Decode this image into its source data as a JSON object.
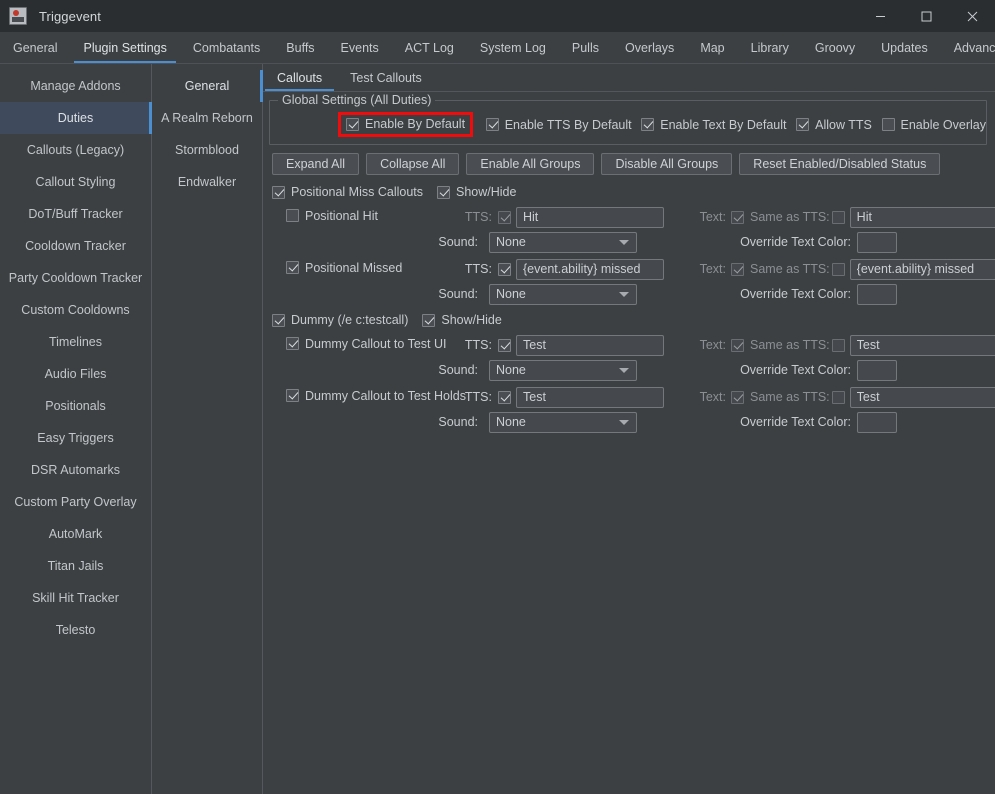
{
  "window": {
    "title": "Triggevent",
    "icon": "app-icon",
    "controls": {
      "minimize": "minimize-icon",
      "maximize": "maximize-icon",
      "close": "close-icon"
    }
  },
  "main_tabs": {
    "active": "Plugin Settings",
    "items": [
      "General",
      "Plugin Settings",
      "Combatants",
      "Buffs",
      "Events",
      "ACT Log",
      "System Log",
      "Pulls",
      "Overlays",
      "Map",
      "Library",
      "Groovy",
      "Updates",
      "Advanced"
    ]
  },
  "sidebar": {
    "selected": "Duties",
    "items": [
      "Manage Addons",
      "Duties",
      "Callouts (Legacy)",
      "Callout Styling",
      "DoT/Buff Tracker",
      "Cooldown Tracker",
      "Party Cooldown Tracker",
      "Custom Cooldowns",
      "Timelines",
      "Audio Files",
      "Positionals",
      "Easy Triggers",
      "DSR Automarks",
      "Custom Party Overlay",
      "AutoMark",
      "Titan Jails",
      "Skill Hit Tracker",
      "Telesto"
    ]
  },
  "expansion_list": {
    "selected": "General",
    "items": [
      "General",
      "A Realm Reborn",
      "Stormblood",
      "Endwalker"
    ]
  },
  "sub_tabs": {
    "active": "Callouts",
    "items": [
      "Callouts",
      "Test Callouts"
    ]
  },
  "global_settings": {
    "title": "Global Settings (All Duties)",
    "checkboxes": [
      {
        "label": "Enable By Default",
        "checked": true,
        "highlighted": true
      },
      {
        "label": "Enable TTS By Default",
        "checked": true,
        "highlighted": false
      },
      {
        "label": "Enable Text By Default",
        "checked": true,
        "highlighted": false
      },
      {
        "label": "Allow TTS",
        "checked": true,
        "highlighted": false
      },
      {
        "label": "Enable Overlay",
        "checked": false,
        "highlighted": false
      }
    ]
  },
  "toolbar": {
    "buttons": [
      "Expand All",
      "Collapse All",
      "Enable All Groups",
      "Disable All Groups",
      "Reset Enabled/Disabled Status"
    ]
  },
  "labels": {
    "tts": "TTS:",
    "sound": "Sound:",
    "text": "Text:",
    "same_as_tts": "Same as TTS:",
    "override_text_color": "Override Text Color:"
  },
  "groups": [
    {
      "name": "Positional Miss Callouts",
      "enabled": true,
      "show_hide_label": "Show/Hide",
      "show_hide_checked": true,
      "items": [
        {
          "name": "Positional Hit",
          "enabled": false,
          "tts_enabled": true,
          "tts_value": "Hit",
          "sound_value": "None",
          "same_as_tts_checked": true,
          "text_override_checked": false,
          "text_value": "Hit",
          "color_value": ""
        },
        {
          "name": "Positional Missed",
          "enabled": true,
          "tts_enabled": true,
          "tts_value": "{event.ability} missed",
          "sound_value": "None",
          "same_as_tts_checked": true,
          "text_override_checked": false,
          "text_value": "{event.ability} missed",
          "color_value": ""
        }
      ]
    },
    {
      "name": "Dummy (/e c:testcall)",
      "enabled": true,
      "show_hide_label": "Show/Hide",
      "show_hide_checked": true,
      "items": [
        {
          "name": "Dummy Callout to Test UI",
          "enabled": true,
          "tts_enabled": true,
          "tts_value": "Test",
          "sound_value": "None",
          "same_as_tts_checked": true,
          "text_override_checked": false,
          "text_value": "Test",
          "color_value": ""
        },
        {
          "name": "Dummy Callout to Test Holds",
          "enabled": true,
          "tts_enabled": true,
          "tts_value": "Test",
          "sound_value": "None",
          "same_as_tts_checked": true,
          "text_override_checked": false,
          "text_value": "Test",
          "color_value": ""
        }
      ]
    }
  ],
  "colors": {
    "accent": "#4b8fd0",
    "highlight": "#f00c0c",
    "background": "#3c4043",
    "titlebar": "#2b2e31",
    "selected_row": "#3f4b5c"
  }
}
